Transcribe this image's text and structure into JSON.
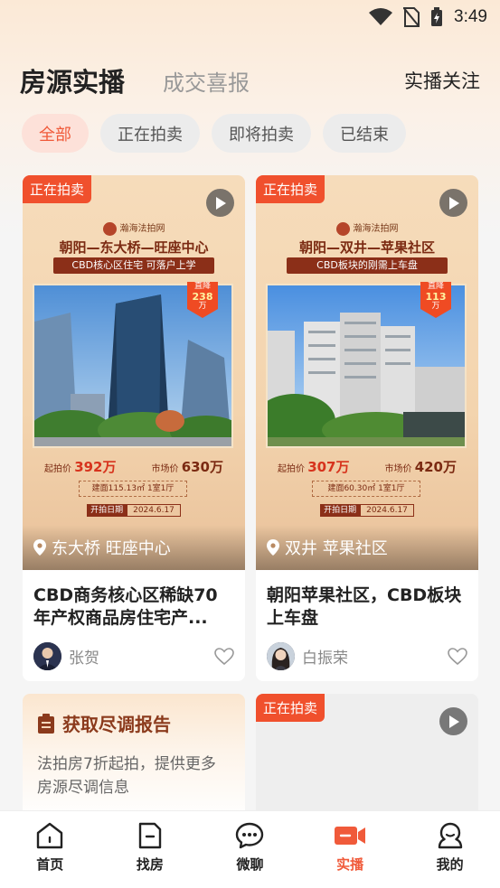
{
  "status_bar": {
    "time": "3:49"
  },
  "header": {
    "tab_active": "房源实播",
    "tab_inactive": "成交喜报",
    "follow_label": "实播关注"
  },
  "filters": [
    "全部",
    "正在拍卖",
    "即将拍卖",
    "已结束"
  ],
  "cards": [
    {
      "badge": "正在拍卖",
      "poster": {
        "logo": "瀚海法拍网",
        "title": "朝阳—东大桥—旺座中心",
        "banner": "CBD核心区住宅 可落户上学",
        "drop_label": "直降",
        "drop_value": "238",
        "drop_unit": "万",
        "start_label": "起拍价",
        "start_price": "392万",
        "market_label": "市场价",
        "market_price": "630万",
        "area": "建面115.13㎡ 1室1厅",
        "date_label": "开拍日期",
        "date": "2024.6.17"
      },
      "location": "东大桥 旺座中心",
      "title": "CBD商务核心区稀缺70年产权商品房住宅产...",
      "author": "张贺"
    },
    {
      "badge": "正在拍卖",
      "poster": {
        "logo": "瀚海法拍网",
        "title": "朝阳—双井—苹果社区",
        "banner": "CBD板块的刚需上车盘",
        "drop_label": "直降",
        "drop_value": "113",
        "drop_unit": "万",
        "start_label": "起拍价",
        "start_price": "307万",
        "market_label": "市场价",
        "market_price": "420万",
        "area": "建面60.30㎡ 1室1厅",
        "date_label": "开拍日期",
        "date": "2024.6.17"
      },
      "location": "双井 苹果社区",
      "title": "朝阳苹果社区，CBD板块上车盘",
      "author": "白振荣"
    }
  ],
  "report": {
    "title": "获取尽调报告",
    "desc": "法拍房7折起拍，提供更多房源尽调信息"
  },
  "card3": {
    "badge": "正在拍卖"
  },
  "nav": [
    {
      "label": "首页",
      "icon": "home-icon"
    },
    {
      "label": "找房",
      "icon": "doc-icon"
    },
    {
      "label": "微聊",
      "icon": "chat-icon"
    },
    {
      "label": "实播",
      "icon": "video-icon"
    },
    {
      "label": "我的",
      "icon": "user-icon"
    }
  ],
  "colors": {
    "accent": "#f05a3a",
    "badge": "#f0502d",
    "poster_dark": "#8b2f18"
  }
}
